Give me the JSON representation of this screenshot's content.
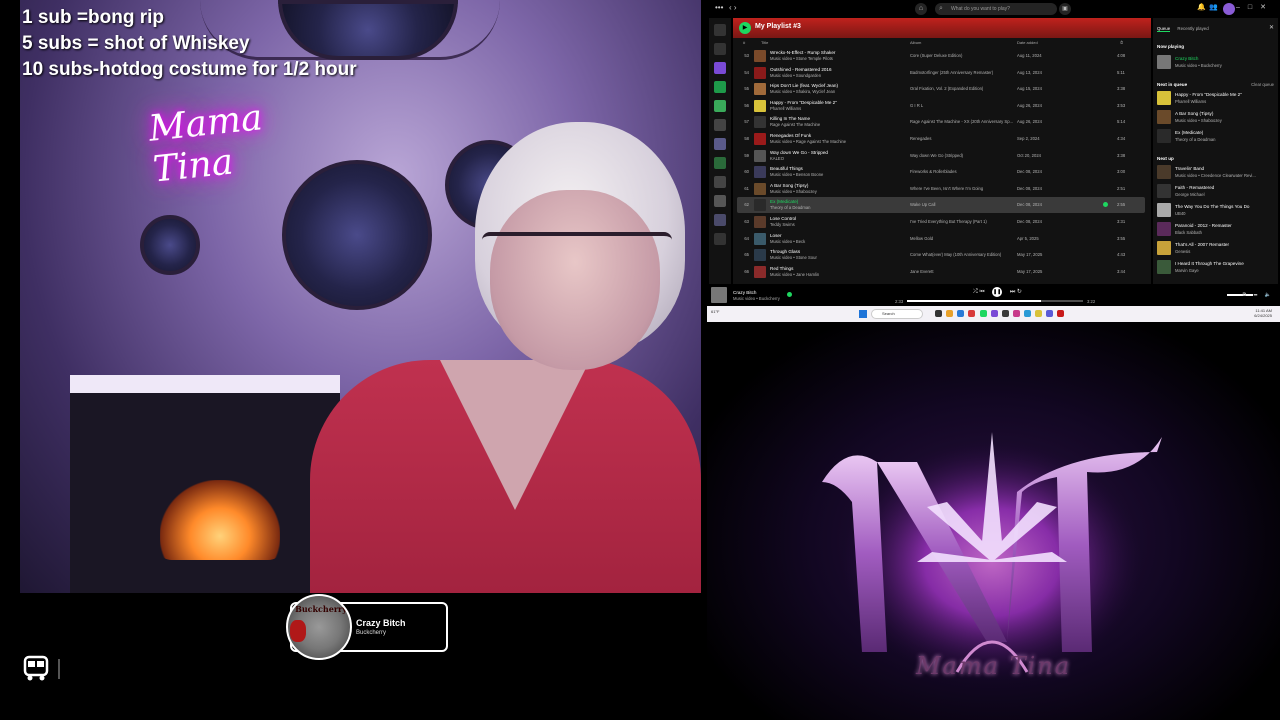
{
  "overlay": {
    "rules": [
      "1 sub   =bong rip",
      "5 subs = shot of Whiskey",
      "10 subs-hotdog costume for 1/2 hour"
    ],
    "neon_sign": "Mama Tina"
  },
  "now_playing_widget": {
    "title": "Crazy Bitch",
    "artist": "Buckcherry",
    "art_text": "Buckcherry"
  },
  "spotify": {
    "search_placeholder": "What do you want to play?",
    "playlist_title": "My Playlist #3",
    "columns": {
      "num": "#",
      "title": "Title",
      "album": "Album",
      "date": "Date added",
      "duration": "⏱"
    },
    "rows": [
      {
        "num": "53",
        "title": "Wreckx-N-Effect - Rump Shaker",
        "artist": "Music video • Stone Temple Pilots",
        "album": "Core (Super Deluxe Edition)",
        "date": "Aug 11, 2024",
        "duration": "4:08",
        "color": "#7a4a2a"
      },
      {
        "num": "54",
        "title": "Outshined - Remastered 2016",
        "artist": "Music video • Soundgarden",
        "album": "Badmotorfinger (25th Anniversary Remaster)",
        "date": "Aug 13, 2024",
        "duration": "5:11",
        "color": "#8a1a1a"
      },
      {
        "num": "55",
        "title": "Hips Don't Lie (feat. Wyclef Jean)",
        "artist": "Music video • Shakira, Wyclef Jean",
        "album": "Oral Fixation, Vol. 2 (Expanded Edition)",
        "date": "Aug 15, 2024",
        "duration": "3:38",
        "color": "#a06a3a"
      },
      {
        "num": "56",
        "title": "Happy - From \"Despicable Me 2\"",
        "artist": "Pharrell Williams",
        "album": "G I R L",
        "date": "Aug 26, 2024",
        "duration": "3:53",
        "color": "#d8c23a"
      },
      {
        "num": "57",
        "title": "Killing In The Name",
        "artist": "Rage Against The Machine",
        "album": "Rage Against The Machine - XX (20th Anniversary Sp...",
        "date": "Aug 26, 2024",
        "duration": "5:14",
        "color": "#333"
      },
      {
        "num": "58",
        "title": "Renegades Of Funk",
        "artist": "Music video • Rage Against The Machine",
        "album": "Renegades",
        "date": "Sep 2, 2024",
        "duration": "4:34",
        "color": "#9a1a1a"
      },
      {
        "num": "59",
        "title": "Way down We Go - Stripped",
        "artist": "KALEO",
        "album": "Way down We Go (Stripped)",
        "date": "Oct 20, 2024",
        "duration": "3:38",
        "color": "#555"
      },
      {
        "num": "60",
        "title": "Beautiful Things",
        "artist": "Music video • Benson Boone",
        "album": "Fireworks & Rollerblades",
        "date": "Dec 08, 2024",
        "duration": "3:00",
        "color": "#3a3a5a"
      },
      {
        "num": "61",
        "title": "A Bar Song (Tipsy)",
        "artist": "Music video • Shaboozey",
        "album": "Where I've Been, Isn't Where I'm Going",
        "date": "Dec 08, 2024",
        "duration": "2:51",
        "color": "#6a4a2a"
      },
      {
        "num": "62",
        "title": "Ex (Medicate)",
        "artist": "Theory of a Deadman",
        "album": "Wake Up Call",
        "date": "Dec 08, 2024",
        "duration": "2:55",
        "color": "#2a2a2a",
        "active": true
      },
      {
        "num": "63",
        "title": "Lose Control",
        "artist": "Teddy Swims",
        "album": "I've Tried Everything But Therapy (Part 1)",
        "date": "Dec 08, 2024",
        "duration": "3:31",
        "color": "#5a3a2a"
      },
      {
        "num": "64",
        "title": "Loser",
        "artist": "Music video • Beck",
        "album": "Mellow Gold",
        "date": "Apr 5, 2025",
        "duration": "3:55",
        "color": "#3a5a6a"
      },
      {
        "num": "65",
        "title": "Through Glass",
        "artist": "Music video • Stone Sour",
        "album": "Come What(ever) May (10th Anniversary Edition)",
        "date": "May 17, 2025",
        "duration": "4:43",
        "color": "#2a3a4a"
      },
      {
        "num": "66",
        "title": "Red Things",
        "artist": "Music video • Jane Hamlin",
        "album": "Jane Everett",
        "date": "May 17, 2025",
        "duration": "3:44",
        "color": "#8a2a2a"
      }
    ],
    "queue": {
      "tabs": [
        "Queue",
        "Recently played"
      ],
      "now_playing_label": "Now playing",
      "now_playing": {
        "title": "Crazy Bitch",
        "artist": "Music video • Buckcherry",
        "color": "#777"
      },
      "next_in_queue_label": "Next in queue",
      "clear_label": "Clear queue",
      "next_in_queue": [
        {
          "title": "Happy - From \"Despicable Me 2\"",
          "artist": "Pharrell Williams",
          "color": "#d8c23a"
        },
        {
          "title": "A Bar Song (Tipsy)",
          "artist": "Music video • Shaboozey",
          "color": "#6a4a2a"
        },
        {
          "title": "Ex (Medicate)",
          "artist": "Theory of a Deadman",
          "color": "#2a2a2a"
        }
      ],
      "next_up_label": "Next up",
      "next_up": [
        {
          "title": "Travelin' Band",
          "artist": "Music video • Creedence Clearwater Revi...",
          "color": "#4a3a2a"
        },
        {
          "title": "Faith - Remastered",
          "artist": "George Michael",
          "color": "#333"
        },
        {
          "title": "The Way You Do The Things You Do",
          "artist": "UB40",
          "color": "#aaa"
        },
        {
          "title": "Paranoid - 2012 - Remaster",
          "artist": "Black Sabbath",
          "color": "#5a2a5a"
        },
        {
          "title": "That's All - 2007 Remaster",
          "artist": "Genesis",
          "color": "#c8a23a"
        },
        {
          "title": "I Heard It Through The Grapevine",
          "artist": "Marvin Gaye",
          "color": "#3a5a3a"
        }
      ]
    },
    "player": {
      "title": "Crazy Bitch",
      "artist": "Music video • Buckcherry",
      "elapsed": "2:33",
      "total": "3:22",
      "progress": 0.76
    },
    "taskbar": {
      "weather": "61°F",
      "search_placeholder": "Search",
      "time": "11:41 AM",
      "date": "6/24/2025"
    }
  },
  "logo": {
    "name": "Mama Tina"
  }
}
